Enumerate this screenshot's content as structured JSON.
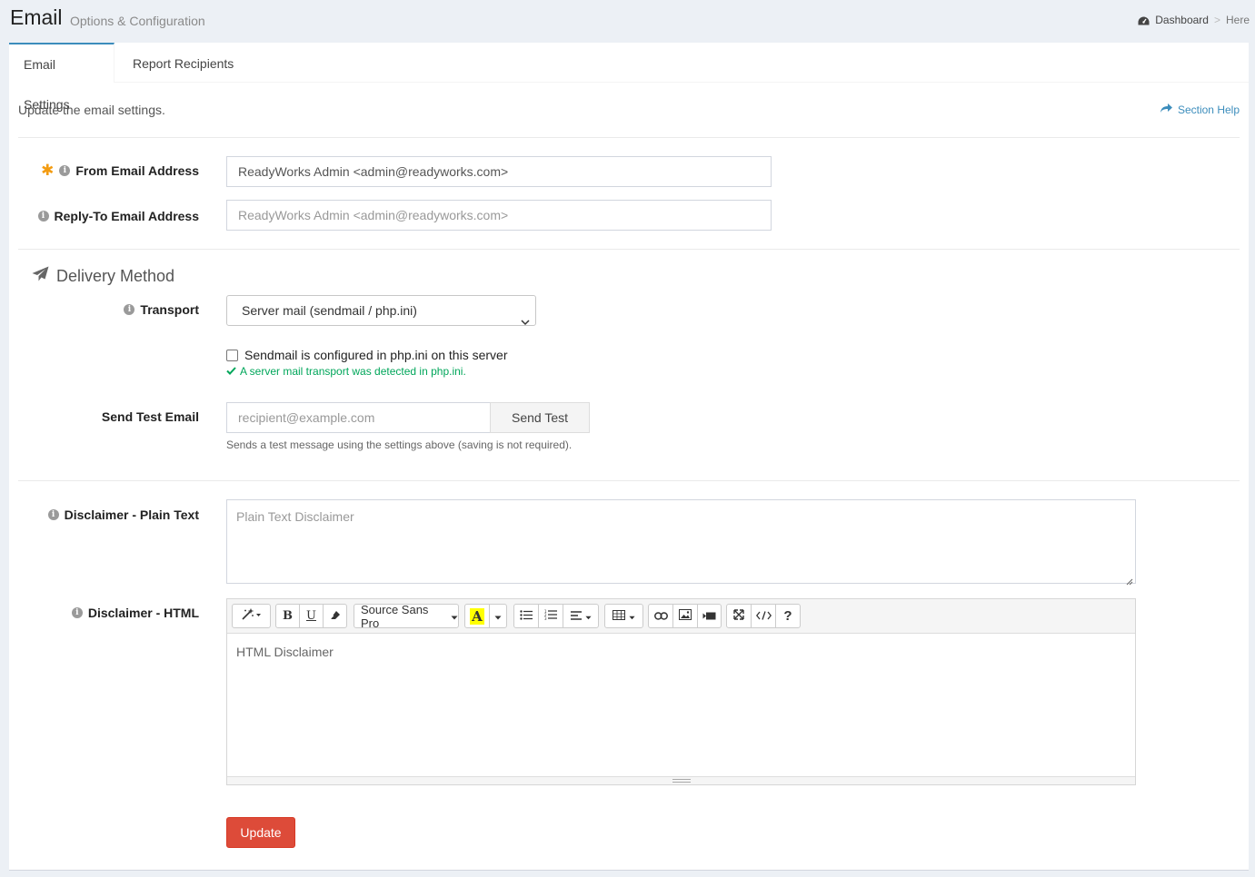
{
  "header": {
    "title": "Email",
    "subtitle": "Options & Configuration",
    "breadcrumb": {
      "dashboard": "Dashboard",
      "separator": ">",
      "here": "Here"
    }
  },
  "tabs": [
    {
      "label": "Email Settings",
      "active": true
    },
    {
      "label": "Report Recipients",
      "active": false
    }
  ],
  "intro": "Update the email settings.",
  "section_help": "Section Help",
  "form": {
    "from_email": {
      "label": "From Email Address",
      "value": "ReadyWorks Admin <admin@readyworks.com>",
      "required": true
    },
    "reply_to": {
      "label": "Reply-To Email Address",
      "placeholder": "ReadyWorks Admin <admin@readyworks.com>"
    },
    "delivery_heading": "Delivery Method",
    "transport": {
      "label": "Transport",
      "selected": "Server mail (sendmail / php.ini)"
    },
    "sendmail_checkbox": {
      "label": "Sendmail is configured in php.ini on this server",
      "checked": false
    },
    "detected_note": "A server mail transport was detected in php.ini.",
    "send_test": {
      "label": "Send Test Email",
      "placeholder": "recipient@example.com",
      "button": "Send Test",
      "hint": "Sends a test message using the settings above (saving is not required)."
    },
    "disclaimer_plain": {
      "label": "Disclaimer - Plain Text",
      "placeholder": "Plain Text Disclaimer"
    },
    "disclaimer_html": {
      "label": "Disclaimer - HTML",
      "placeholder": "HTML Disclaimer",
      "font_name": "Source Sans Pro"
    },
    "update_button": "Update"
  },
  "colors": {
    "accent": "#3c8dbc",
    "danger": "#dd4b39",
    "success": "#00a65a",
    "required": "#f39c12"
  }
}
